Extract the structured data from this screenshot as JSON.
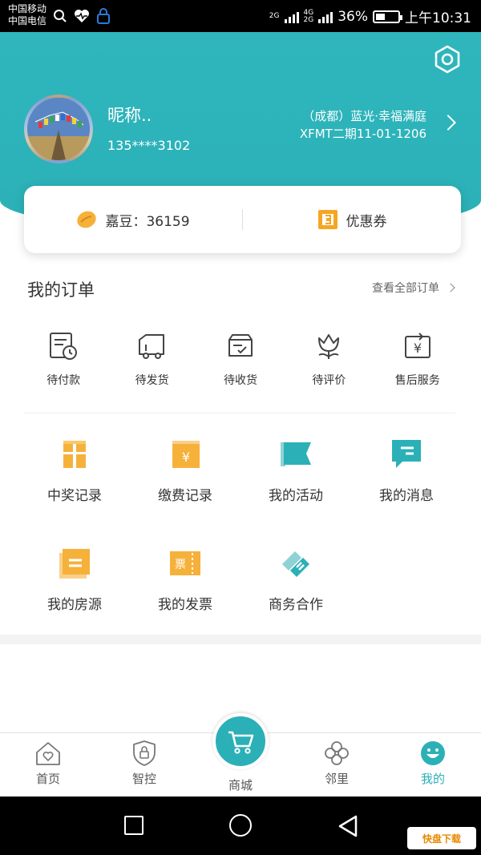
{
  "status_bar": {
    "carrier1": "中国移动",
    "carrier2": "中国电信",
    "net1": "2G",
    "net2": "4G",
    "net3": "2G",
    "battery": "36%",
    "time": "上午10:31"
  },
  "profile": {
    "nickname": "昵称..",
    "phone": "135****3102",
    "address_line1": "（成都）蓝光·幸福满庭",
    "address_line2": "XFMT二期11-01-1206"
  },
  "points_card": {
    "beans_label": "嘉豆：",
    "beans_value": "36159",
    "coupon_label": "优惠券"
  },
  "orders": {
    "title": "我的订单",
    "view_all": "查看全部订单",
    "items": [
      {
        "label": "待付款",
        "icon": "pending-payment-icon"
      },
      {
        "label": "待发货",
        "icon": "pending-shipment-icon"
      },
      {
        "label": "待收货",
        "icon": "pending-receipt-icon"
      },
      {
        "label": "待评价",
        "icon": "pending-review-icon"
      },
      {
        "label": "售后服务",
        "icon": "after-sales-icon"
      }
    ]
  },
  "features": [
    {
      "label": "中奖记录",
      "icon": "gift-icon"
    },
    {
      "label": "缴费记录",
      "icon": "payment-record-icon"
    },
    {
      "label": "我的活动",
      "icon": "activity-flag-icon"
    },
    {
      "label": "我的消息",
      "icon": "message-icon"
    },
    {
      "label": "我的房源",
      "icon": "house-listing-icon"
    },
    {
      "label": "我的发票",
      "icon": "invoice-icon"
    },
    {
      "label": "商务合作",
      "icon": "cooperation-icon"
    }
  ],
  "invoice_glyph": "票",
  "yen_glyph": "¥",
  "tabs": [
    {
      "label": "首页",
      "icon": "home-icon"
    },
    {
      "label": "智控",
      "icon": "smart-control-icon"
    },
    {
      "label": "商城",
      "icon": "cart-icon"
    },
    {
      "label": "邻里",
      "icon": "neighbor-icon"
    },
    {
      "label": "我的",
      "icon": "profile-smile-icon"
    }
  ],
  "watermark": "快盘下载",
  "colors": {
    "accent": "#2bb0b7",
    "orange": "#f6b13a"
  }
}
